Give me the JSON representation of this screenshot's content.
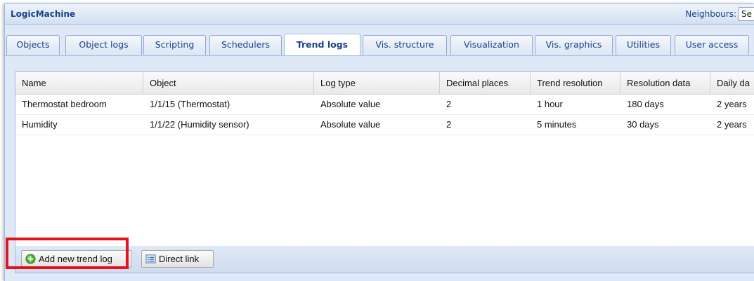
{
  "app": {
    "title": "LogicMachine"
  },
  "header": {
    "neighbours_label": "Neighbours:",
    "neighbours_value": "Se"
  },
  "tabs": [
    {
      "label": "Objects"
    },
    {
      "label": "Object logs"
    },
    {
      "label": "Scripting"
    },
    {
      "label": "Schedulers"
    },
    {
      "label": "Trend logs",
      "active": true
    },
    {
      "label": "Vis. structure"
    },
    {
      "label": "Visualization"
    },
    {
      "label": "Vis. graphics"
    },
    {
      "label": "Utilities"
    },
    {
      "label": "User access"
    }
  ],
  "grid": {
    "columns": [
      "Name",
      "Object",
      "Log type",
      "Decimal places",
      "Trend resolution",
      "Resolution data",
      "Daily da"
    ],
    "rows": [
      [
        "Thermostat bedroom",
        "1/1/15 (Thermostat)",
        "Absolute value",
        "2",
        "1 hour",
        "180 days",
        "2 years"
      ],
      [
        "Humidity",
        "1/1/22 (Humidity sensor)",
        "Absolute value",
        "2",
        "5 minutes",
        "30 days",
        "2 years"
      ]
    ]
  },
  "toolbar": {
    "add_label": "Add new trend log",
    "link_label": "Direct link"
  },
  "colors": {
    "highlight": "#e3121b",
    "accent": "#15428b"
  },
  "icons": {
    "add": "add-circle-icon",
    "link": "list-icon"
  }
}
